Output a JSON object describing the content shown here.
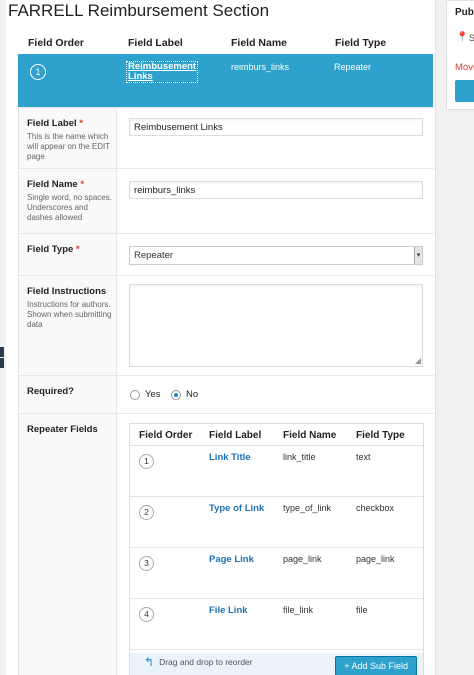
{
  "title": "FARRELL Reimbursement Section",
  "field_table": {
    "columns": [
      "Field Order",
      "Field Label",
      "Field Name",
      "Field Type"
    ],
    "active_row": {
      "order": "1",
      "label": "Reimbusement Links",
      "name": "reimburs_links",
      "type": "Repeater"
    }
  },
  "form": {
    "field_label": {
      "label": "Field Label",
      "required_mark": "*",
      "description": "This is the name which will appear on the EDIT page",
      "value": "Reimbusement Links"
    },
    "field_name": {
      "label": "Field Name",
      "required_mark": "*",
      "description": "Single word, no spaces. Underscores and dashes allowed",
      "value": "reimburs_links"
    },
    "field_type": {
      "label": "Field Type",
      "required_mark": "*",
      "value": "Repeater",
      "arrow": "▾"
    },
    "field_instructions": {
      "label": "Field Instructions",
      "description": "Instructions for authors. Shown when submitting data",
      "value": ""
    },
    "required": {
      "label": "Required?",
      "options": [
        "Yes",
        "No"
      ],
      "selected": "No"
    },
    "repeater_fields": {
      "label": "Repeater Fields",
      "columns": [
        "Field Order",
        "Field Label",
        "Field Name",
        "Field Type"
      ],
      "rows": [
        {
          "order": "1",
          "label": "Link Title",
          "name": "link_title",
          "type": "text"
        },
        {
          "order": "2",
          "label": "Type of Link",
          "name": "type_of_link",
          "type": "checkbox"
        },
        {
          "order": "3",
          "label": "Page Link",
          "name": "page_link",
          "type": "page_link"
        },
        {
          "order": "4",
          "label": "File Link",
          "name": "file_link",
          "type": "file"
        }
      ],
      "drag_hint": "Drag and drop to reorder",
      "drag_icon": "↰",
      "add_button": "+ Add Sub Field"
    }
  },
  "sidebar": {
    "title": "Pub",
    "pin_icon": "pin-icon",
    "pin_glyph": "📍",
    "status_letter": "S",
    "move_label": "Move"
  },
  "colors": {
    "accent": "#2ea2cc",
    "link": "#2271b1",
    "required": "#dd3d36"
  }
}
